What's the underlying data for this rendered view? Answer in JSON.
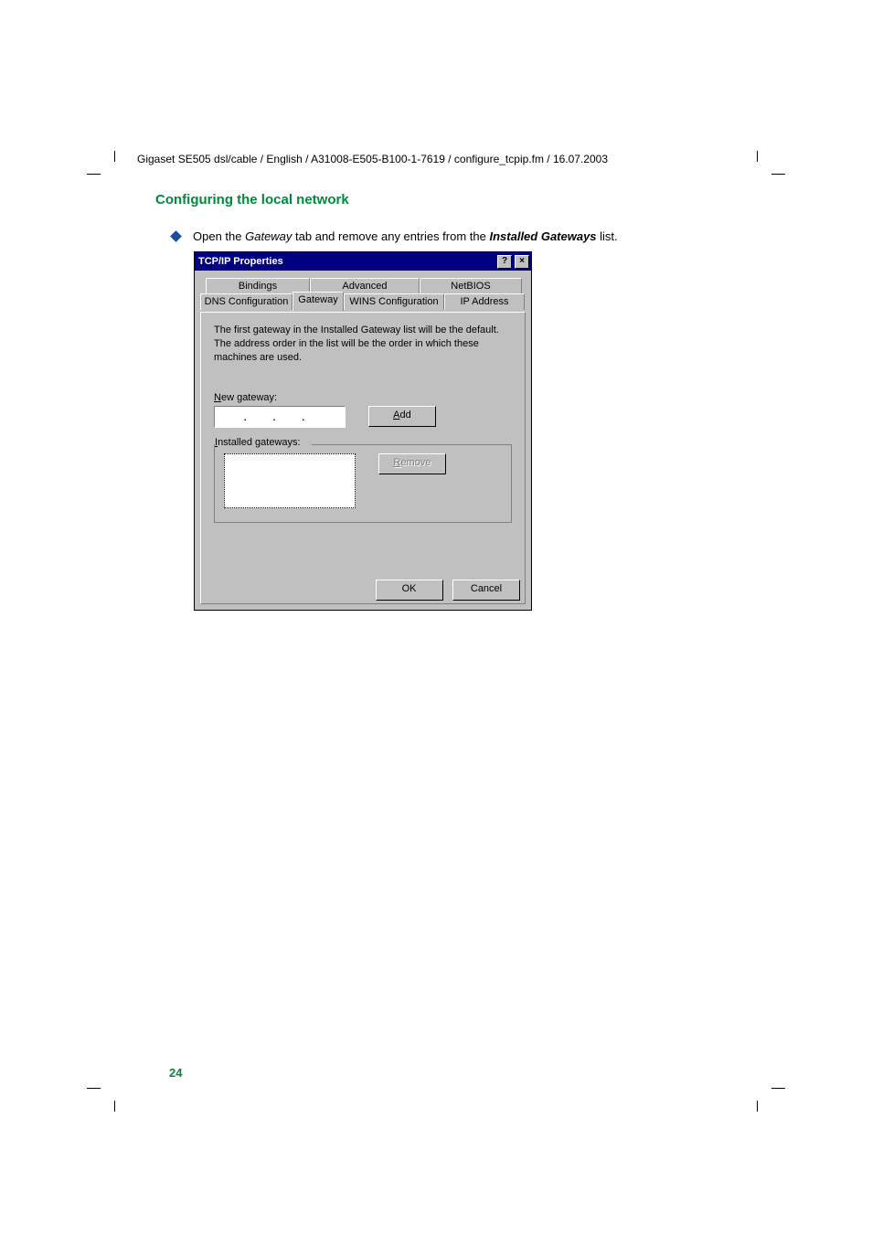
{
  "header": "Gigaset SE505 dsl/cable / English / A31008-E505-B100-1-7619 / configure_tcpip.fm / 16.07.2003",
  "section_heading": "Configuring the local network",
  "bullet": {
    "pre": "Open the ",
    "tab_ref": "Gateway",
    "mid": " tab and remove any entries from the ",
    "list_ref": "Installed Gateways",
    "post": " list."
  },
  "dialog": {
    "title": "TCP/IP Properties",
    "help_btn": "?",
    "close_btn": "×",
    "tabs_back": [
      "Bindings",
      "Advanced",
      "NetBIOS"
    ],
    "tabs_front": [
      "DNS Configuration",
      "Gateway",
      "WINS Configuration",
      "IP Address"
    ],
    "description": "The first gateway in the Installed Gateway list will be the default. The address order in the list will be the order in which these machines are used.",
    "new_gateway_label": "New gateway:",
    "ip_dots": ".     .     .",
    "add_label": "Add",
    "installed_label": "Installed gateways:",
    "remove_label": "Remove",
    "ok_label": "OK",
    "cancel_label": "Cancel"
  },
  "page_number": "24"
}
